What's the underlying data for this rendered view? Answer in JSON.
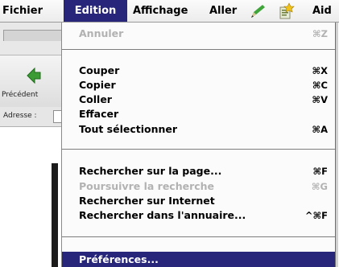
{
  "menubar": {
    "items": [
      {
        "label": "Fichier"
      },
      {
        "label": "Edition"
      },
      {
        "label": "Affichage"
      },
      {
        "label": "Aller"
      },
      {
        "label": "Aid"
      }
    ],
    "icons": [
      "pencil-icon",
      "favorites-icon"
    ]
  },
  "browser": {
    "back_label": "Précédent",
    "address_label": "Adresse :"
  },
  "edit_menu": {
    "items": [
      {
        "label": "Annuler",
        "shortcut": "⌘Z",
        "enabled": false
      },
      {
        "label": "Couper",
        "shortcut": "⌘X",
        "enabled": true
      },
      {
        "label": "Copier",
        "shortcut": "⌘C",
        "enabled": true
      },
      {
        "label": "Coller",
        "shortcut": "⌘V",
        "enabled": true
      },
      {
        "label": "Effacer",
        "shortcut": "",
        "enabled": true
      },
      {
        "label": "Tout sélectionner",
        "shortcut": "⌘A",
        "enabled": true
      },
      {
        "label": "Rechercher sur la page...",
        "shortcut": "⌘F",
        "enabled": true
      },
      {
        "label": "Poursuivre la recherche",
        "shortcut": "⌘G",
        "enabled": false
      },
      {
        "label": "Rechercher sur Internet",
        "shortcut": "",
        "enabled": true
      },
      {
        "label": "Rechercher dans l'annuaire...",
        "shortcut": "^⌘F",
        "enabled": true
      },
      {
        "label": "Préférences...",
        "shortcut": "",
        "enabled": true,
        "selected": true
      }
    ]
  },
  "colors": {
    "highlight": "#27267a",
    "highlight_text": "#ffffff",
    "disabled_text": "#b2b2b2",
    "menu_background": "#fbfbfb"
  }
}
